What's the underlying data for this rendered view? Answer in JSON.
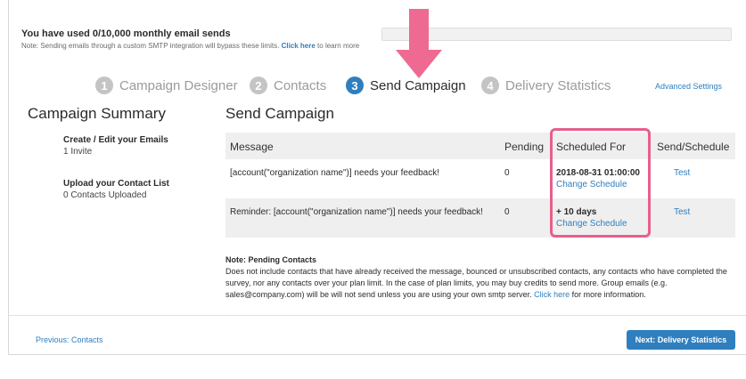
{
  "usage": {
    "title": "You have used 0/10,000 monthly email sends",
    "note_prefix": "Note: Sending emails through a custom SMTP integration will bypass these limits.",
    "note_link": "Click here",
    "note_suffix": "to learn more",
    "used_fraction": 0.0
  },
  "steps": [
    {
      "num": "1",
      "label": "Campaign Designer"
    },
    {
      "num": "2",
      "label": "Contacts"
    },
    {
      "num": "3",
      "label": "Send Campaign"
    },
    {
      "num": "4",
      "label": "Delivery Statistics"
    }
  ],
  "advanced_settings": "Advanced Settings",
  "summary": {
    "title": "Campaign Summary",
    "items": [
      {
        "heading": "Create / Edit your Emails",
        "sub": "1 Invite"
      },
      {
        "heading": "Upload your Contact List",
        "sub": "0 Contacts Uploaded"
      }
    ]
  },
  "send": {
    "title": "Send Campaign",
    "headers": [
      "Message",
      "Pending",
      "Scheduled For",
      "Send/Schedule"
    ],
    "rows": [
      {
        "message": "[account(\"organization name\")] needs your feedback!",
        "pending": "0",
        "scheduled": "2018-08-31 01:00:00",
        "change": "Change Schedule",
        "action": "Test"
      },
      {
        "message": "Reminder: [account(\"organization name\")] needs your feedback!",
        "pending": "0",
        "scheduled": "+ 10 days",
        "change": "Change Schedule",
        "action": "Test"
      }
    ]
  },
  "note": {
    "heading": "Note: Pending Contacts",
    "body": "Does not include contacts that have already received the message, bounced or unsubscribed contacts, any contacts who have completed the survey, nor any contacts over your plan limit. In the case of plan limits, you may buy credits to send more. Group emails (e.g. sales@company.com) will be will not send unless you are using your own smtp server.",
    "link": "Click here",
    "suffix": "for more information."
  },
  "footer": {
    "previous": "Previous: Contacts",
    "next": "Next: Delivery Statistics"
  },
  "colors": {
    "accent": "#2f7fbf",
    "highlight": "#e75f8a"
  }
}
